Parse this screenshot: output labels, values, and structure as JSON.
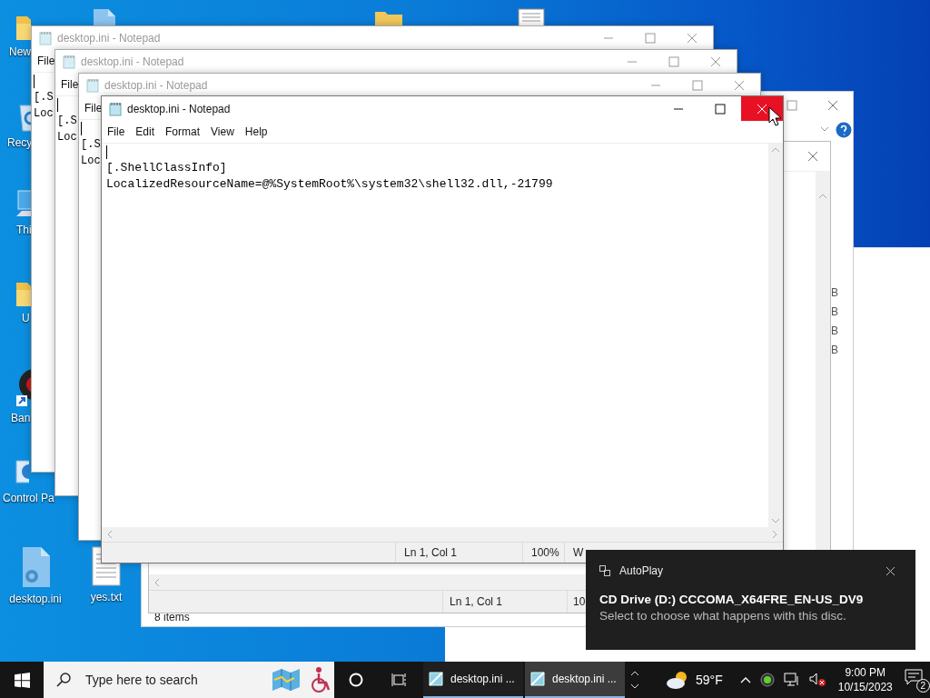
{
  "desktop_icons": [
    {
      "label": "New",
      "kind": "folder"
    },
    {
      "label": "Recy",
      "kind": "recycle-bin"
    },
    {
      "label": "Thi",
      "kind": "computer"
    },
    {
      "label": "U",
      "kind": "folder"
    },
    {
      "label": "Ban",
      "kind": "app"
    },
    {
      "label": "Control Pa",
      "kind": "control-panel"
    },
    {
      "label": "desktop.ini",
      "kind": "settings-file"
    },
    {
      "label": "yes.txt",
      "kind": "text-file"
    }
  ],
  "explorer": {
    "size_column": [
      "B",
      "B",
      "B",
      "B"
    ],
    "status": "8 items"
  },
  "hidden_notepad": {
    "position": "Ln 1, Col 1",
    "zoom": "10"
  },
  "back_notepads": [
    {
      "title": "desktop.ini - Notepad",
      "menu": "File",
      "lines": [
        "[.S",
        "Loc"
      ]
    },
    {
      "title": "desktop.ini - Notepad",
      "menu": "File",
      "lines": [
        "[.S",
        "Loc"
      ]
    },
    {
      "title": "desktop.ini - Notepad",
      "menu": "File",
      "lines": [
        "[.S",
        "Loc"
      ]
    }
  ],
  "notepad": {
    "title": "desktop.ini - Notepad",
    "close_hover": true,
    "menu": [
      "File",
      "Edit",
      "Format",
      "View",
      "Help"
    ],
    "lines": [
      "[.ShellClassInfo]",
      "LocalizedResourceName=@%SystemRoot%\\system32\\shell32.dll,-21799"
    ],
    "status": {
      "position": "Ln 1, Col 1",
      "zoom": "100%",
      "encoding": "W"
    }
  },
  "toast": {
    "app": "AutoPlay",
    "title": "CD Drive (D:) CCCOMA_X64FRE_EN-US_DV9",
    "message": "Select to choose what happens with this disc."
  },
  "taskbar": {
    "search_placeholder": "Type here to search",
    "apps": [
      {
        "label": "desktop.ini ...",
        "selected": false
      },
      {
        "label": "desktop.ini ...",
        "selected": true
      }
    ],
    "weather": "59°F",
    "time": "9:00 PM",
    "date": "10/15/2023",
    "notification_count": "2"
  }
}
